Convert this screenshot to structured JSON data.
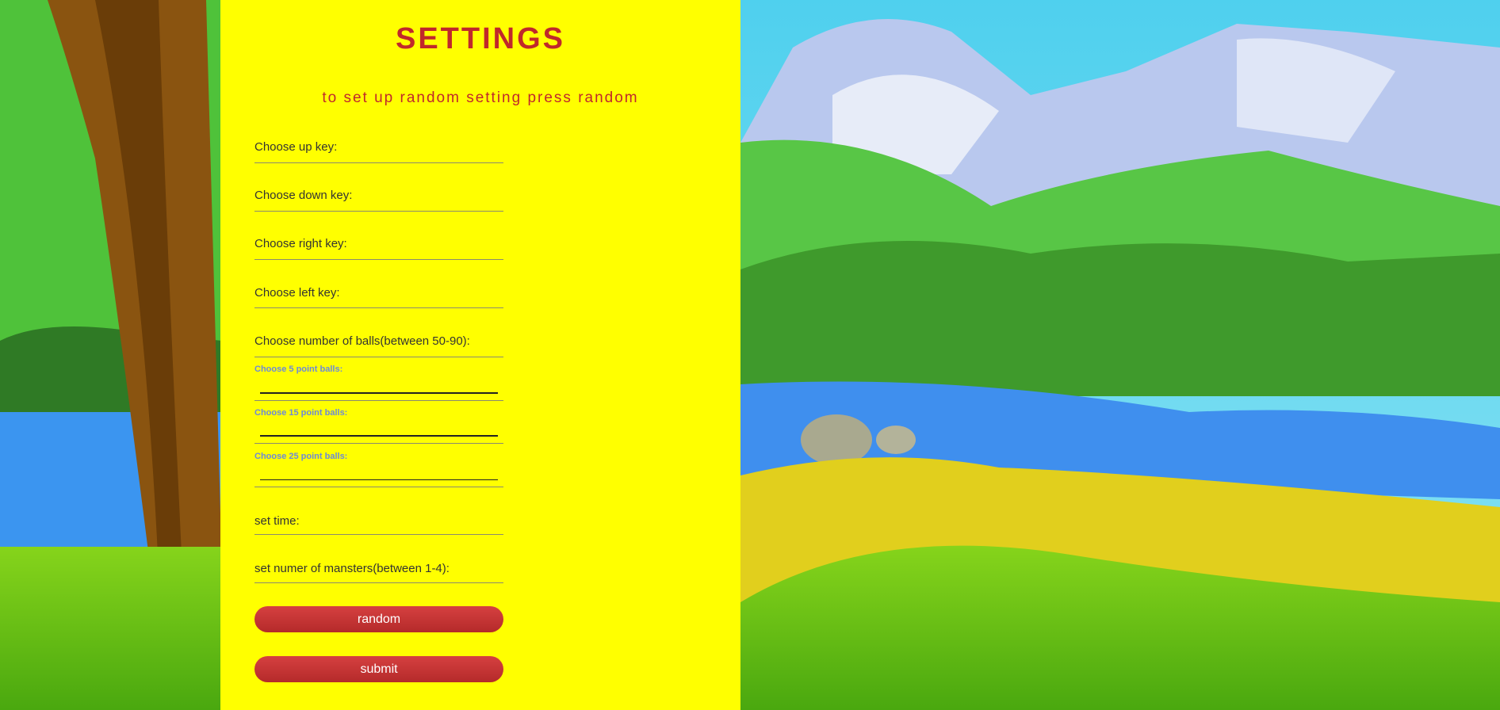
{
  "settings": {
    "title": "SETTINGS",
    "subtitle": "to set up random setting press random",
    "fields": {
      "up_key": "Choose up key:",
      "down_key": "Choose down key:",
      "right_key": "Choose right key:",
      "left_key": "Choose left key:",
      "num_balls": "Choose number of balls(between 50-90):",
      "balls_5": "Choose 5 point balls:",
      "balls_15": "Choose 15 point balls:",
      "balls_25": "Choose 25 point balls:",
      "time": "set time:",
      "monsters": "set numer of mansters(between 1-4):"
    },
    "random_label": "random",
    "submit_label": "submit",
    "colors": {
      "panel": "#ffff00",
      "title": "#c0282b",
      "button": "#c63333",
      "sub_label": "#6d8ad8"
    }
  }
}
